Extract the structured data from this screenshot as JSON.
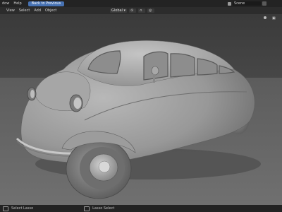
{
  "menu": {
    "items": [
      "dow",
      "Help"
    ],
    "back_button": "Back to Previous"
  },
  "header_right": {
    "scene_label": "Scene"
  },
  "viewport_header": {
    "view_menu": "View",
    "select_menu": "Select",
    "add_menu": "Add",
    "object_menu": "Object",
    "transform_orientation": "Global"
  },
  "statusbar": {
    "left_hint": "Select Lasso",
    "mid_hint": "Lasso Select"
  },
  "colors": {
    "accent": "#4772b3",
    "background": "#3a3a3a",
    "header": "#232323"
  },
  "icons": [
    "chevron-down-icon",
    "grid-icon",
    "magnet-icon",
    "camera-icon",
    "sphere-shading-icon",
    "scene-icon",
    "mouse-icon"
  ]
}
